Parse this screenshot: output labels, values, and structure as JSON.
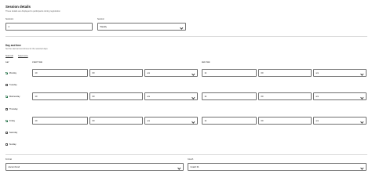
{
  "header": {
    "title": "Session details",
    "description": "These details are displayed to participants during registration"
  },
  "session_fields": [
    {
      "label": "Sessions",
      "value": "4",
      "type": "input"
    },
    {
      "label": "Session",
      "value": "Weekly",
      "type": "select"
    }
  ],
  "day_time": {
    "title": "Day and time",
    "description": "Set the start and end times for the selected days",
    "select_all_label": "Select all",
    "clear_all_label": "Select none",
    "columns": {
      "day": "DAY",
      "start": "START TIME",
      "end": "END TIME"
    },
    "days": [
      {
        "name": "Monday",
        "checked": true,
        "start_h": "10",
        "start_m": "00",
        "start_ampm": "am",
        "end_h": "11",
        "end_m": "00",
        "end_ampm": "am"
      },
      {
        "name": "Tuesday",
        "checked": false
      },
      {
        "name": "Wednesday",
        "checked": true,
        "start_h": "10",
        "start_m": "00",
        "start_ampm": "am",
        "end_h": "11",
        "end_m": "00",
        "end_ampm": "am"
      },
      {
        "name": "Thursday",
        "checked": false
      },
      {
        "name": "Friday",
        "checked": true,
        "start_h": "10",
        "start_m": "00",
        "start_ampm": "am",
        "end_h": "11",
        "end_m": "00",
        "end_ampm": "am"
      },
      {
        "name": "Saturday",
        "checked": false
      },
      {
        "name": "Sunday",
        "checked": false
      }
    ]
  },
  "bottom_fields": [
    {
      "label": "Format",
      "value": "Ascent Fund"
    },
    {
      "label": "Coach",
      "value": "Coach 01"
    }
  ]
}
